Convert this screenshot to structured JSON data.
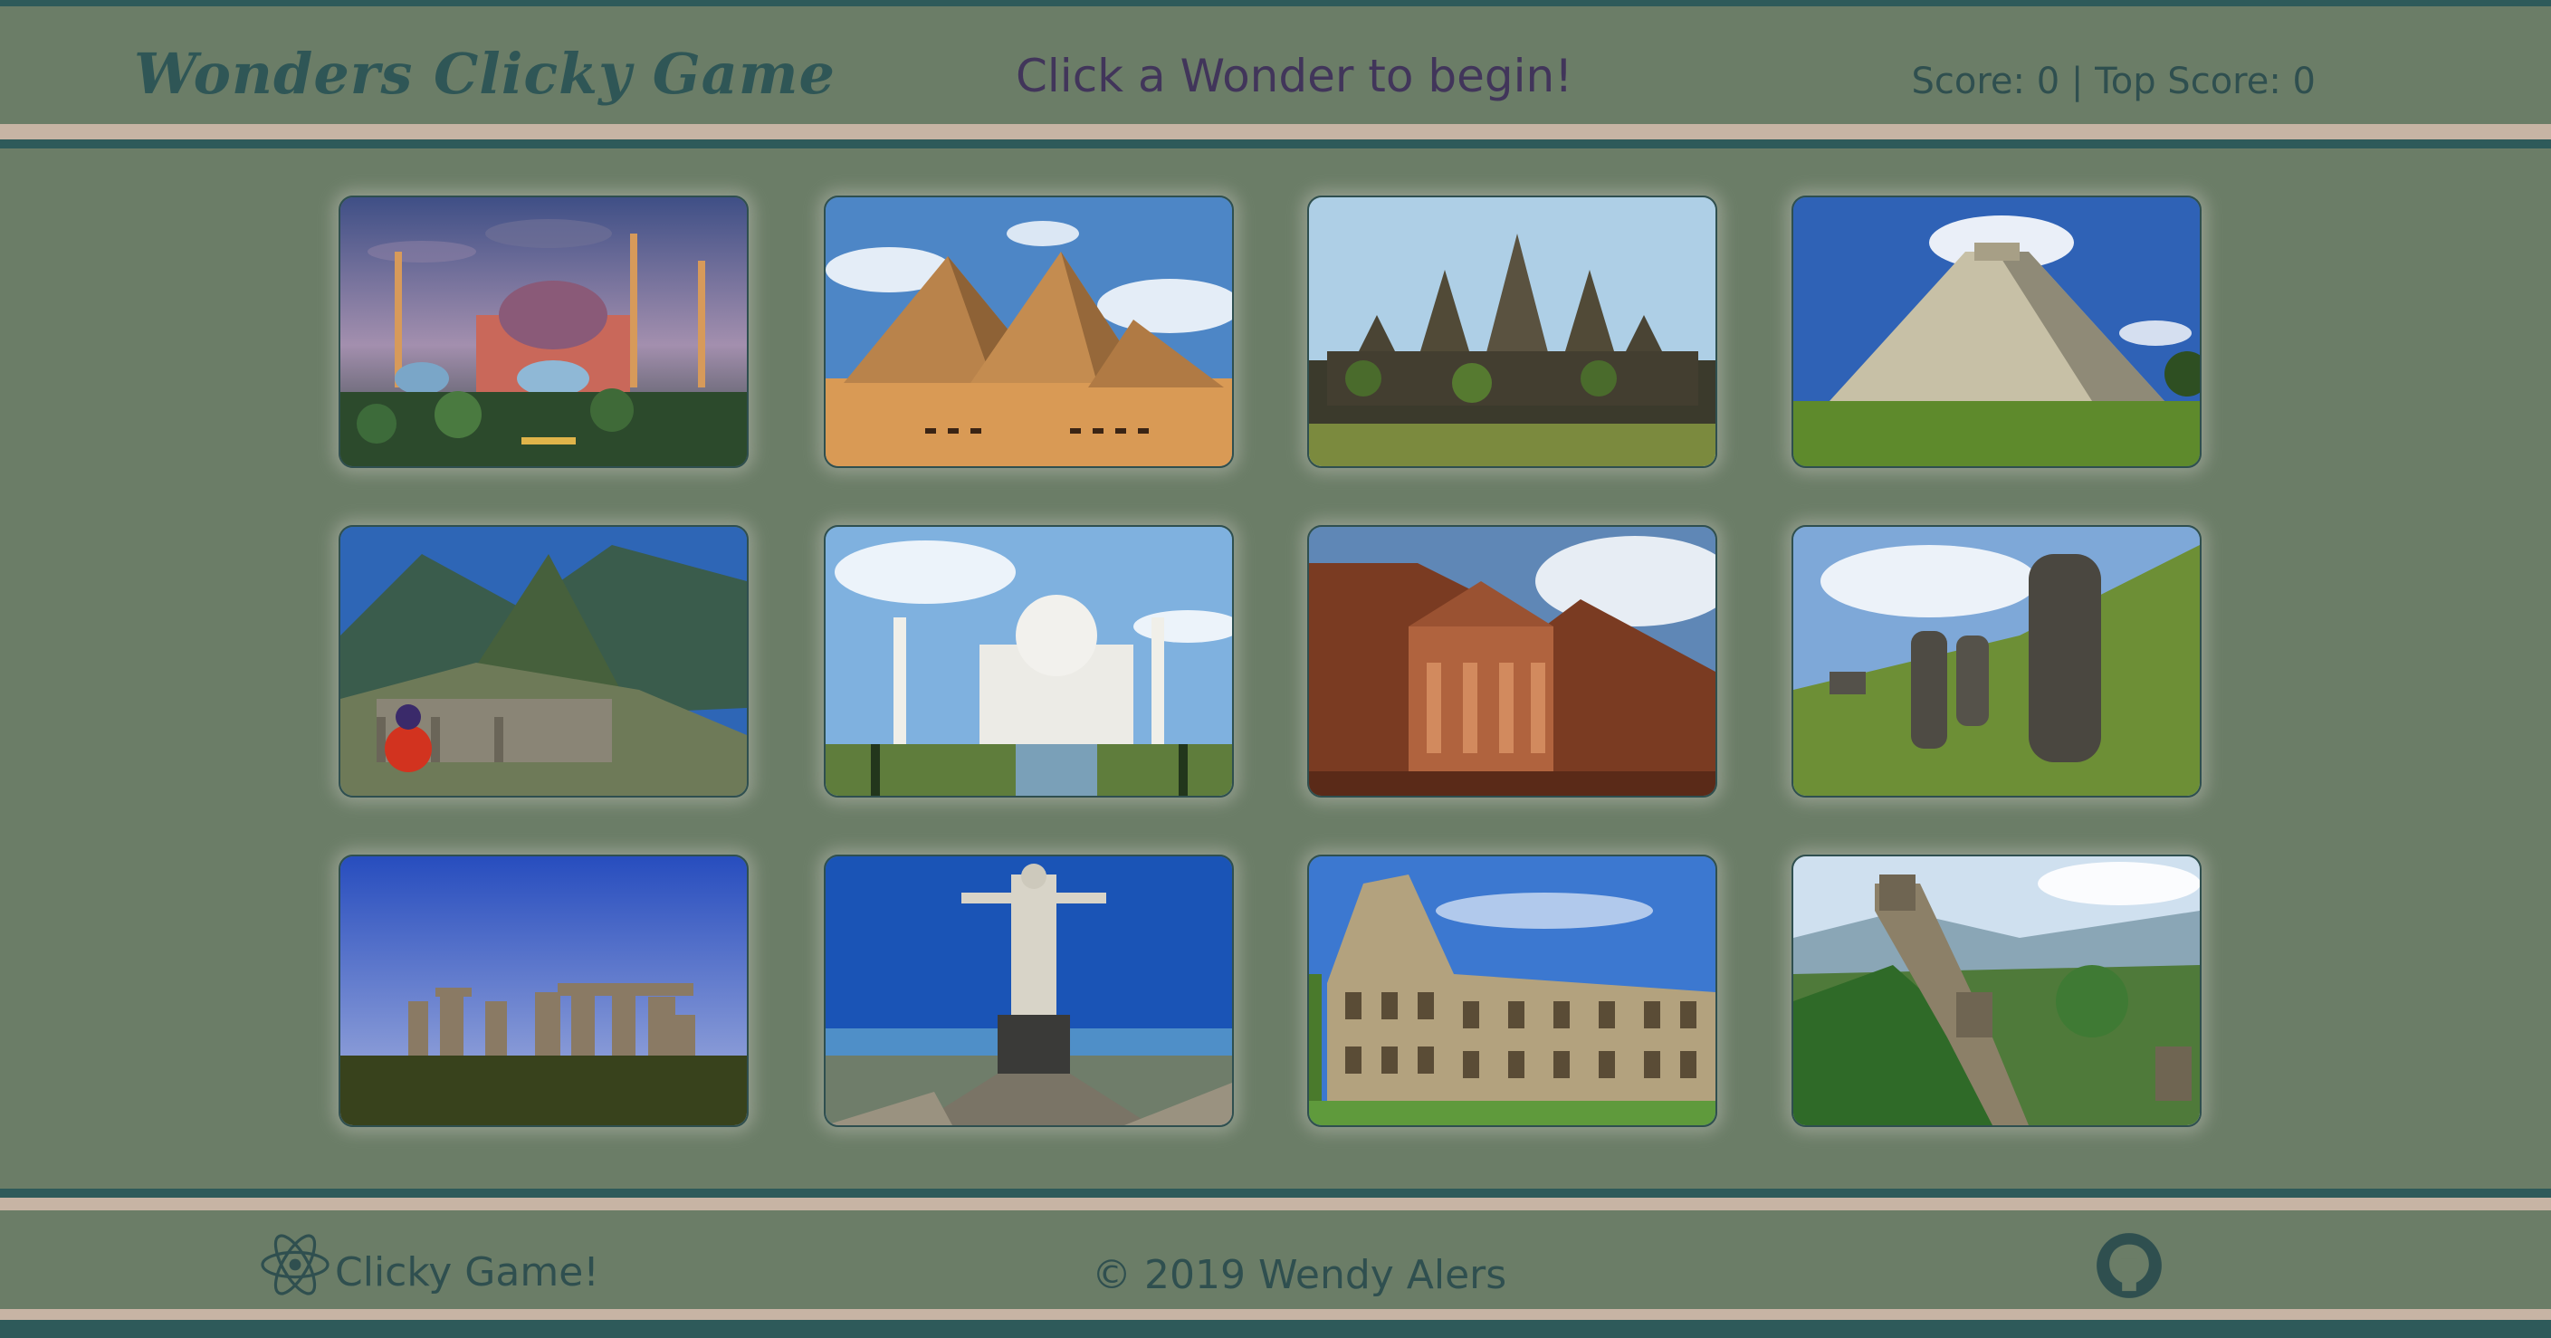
{
  "header": {
    "brand": "Wonders Clicky Game",
    "status": "Click a Wonder to begin!",
    "score_label": "Score:",
    "score": 0,
    "top_score_label": "Top Score:",
    "top_score": 0
  },
  "colors": {
    "background": "#6b7d67",
    "teal": "#2e5a5a",
    "tan": "#c7b4a4",
    "status_text": "#41355a"
  },
  "cards": [
    {
      "name": "hagia-sophia"
    },
    {
      "name": "pyramids-of-giza"
    },
    {
      "name": "angkor-wat"
    },
    {
      "name": "chichen-itza"
    },
    {
      "name": "machu-picchu"
    },
    {
      "name": "taj-mahal"
    },
    {
      "name": "petra"
    },
    {
      "name": "moai-easter-island"
    },
    {
      "name": "stonehenge"
    },
    {
      "name": "christ-the-redeemer"
    },
    {
      "name": "colosseum"
    },
    {
      "name": "great-wall-of-china"
    }
  ],
  "footer": {
    "left_icon": "react-icon",
    "left_text": "Clicky Game!",
    "center_text": "© 2019 Wendy Alers",
    "right_icon": "github-icon"
  }
}
